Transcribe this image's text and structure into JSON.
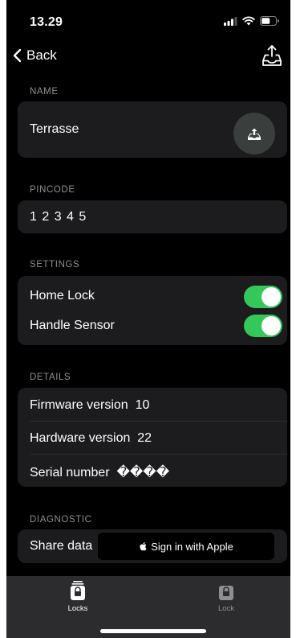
{
  "status": {
    "time": "13.29"
  },
  "nav": {
    "back_label": "Back"
  },
  "name_section": {
    "label": "NAME",
    "value": "Terrasse"
  },
  "pincode_section": {
    "label": "PINCODE",
    "value": "1 2 3 4 5"
  },
  "settings_section": {
    "label": "SETTINGS",
    "home_lock": {
      "label": "Home Lock",
      "enabled": true
    },
    "handle_sensor": {
      "label": "Handle Sensor",
      "enabled": true
    }
  },
  "details_section": {
    "label": "DETAILS",
    "firmware": "Firmware version  10",
    "hardware": "Hardware version  22",
    "serial": "Serial number  ����"
  },
  "diagnostic_section": {
    "label": "DIAGNOSTIC",
    "share_label": "Share data",
    "apple_button": "Sign in with Apple"
  },
  "tabs": [
    {
      "label": "Locks",
      "active": true
    },
    {
      "label": "Lock",
      "active": false
    }
  ],
  "colors": {
    "background": "#000000",
    "card": "#1c1c1e",
    "toggle_on": "#34c759",
    "secondary_text": "#8e8e93",
    "tab_inactive": "#8e8e93"
  },
  "icons": [
    "cellular-signal-icon",
    "wifi-icon",
    "battery-icon",
    "back-chevron-icon",
    "share-icon",
    "lock-icon"
  ]
}
